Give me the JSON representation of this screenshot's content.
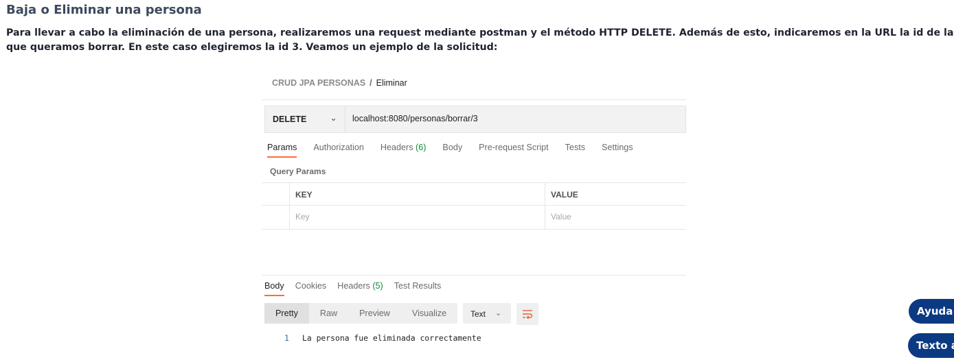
{
  "page": {
    "title": "Baja o Eliminar una persona",
    "intro_line1": "Para llevar a cabo la eliminación de una persona, realizaremos una request mediante postman y el método HTTP DELETE. Además de esto, indicaremos en la URL la id de la persona",
    "intro_line2": "que queramos borrar. En este caso elegiremos la id 3. Veamos un ejemplo de la solicitud:"
  },
  "postman": {
    "breadcrumb": {
      "collection": "CRUD JPA PERSONAS",
      "separator": "/",
      "current": "Eliminar"
    },
    "request": {
      "method": "DELETE",
      "url": "localhost:8080/personas/borrar/3"
    },
    "tabs": [
      {
        "label": "Params",
        "count": ""
      },
      {
        "label": "Authorization",
        "count": ""
      },
      {
        "label": "Headers",
        "count": "(6)"
      },
      {
        "label": "Body",
        "count": ""
      },
      {
        "label": "Pre-request Script",
        "count": ""
      },
      {
        "label": "Tests",
        "count": ""
      },
      {
        "label": "Settings",
        "count": ""
      }
    ],
    "query_params": {
      "title": "Query Params",
      "key_header": "KEY",
      "value_header": "VALUE",
      "key_placeholder": "Key",
      "value_placeholder": "Value"
    },
    "response_tabs": [
      {
        "label": "Body",
        "count": ""
      },
      {
        "label": "Cookies",
        "count": ""
      },
      {
        "label": "Headers",
        "count": "(5)"
      },
      {
        "label": "Test Results",
        "count": ""
      }
    ],
    "format_options": [
      "Pretty",
      "Raw",
      "Preview",
      "Visualize"
    ],
    "response_type": "Text",
    "response": {
      "line_number": "1",
      "text": "La persona fue eliminada correctamente"
    }
  },
  "floating": {
    "help_label": "Ayuda",
    "text_label": "Texto a"
  },
  "colors": {
    "accent": "#ff6c37",
    "count_green": "#0a8a3a",
    "float_blue": "#0c3a82"
  },
  "icons": {
    "method_dropdown": "chevron-down-icon",
    "wrap": "wrap-lines-icon"
  }
}
